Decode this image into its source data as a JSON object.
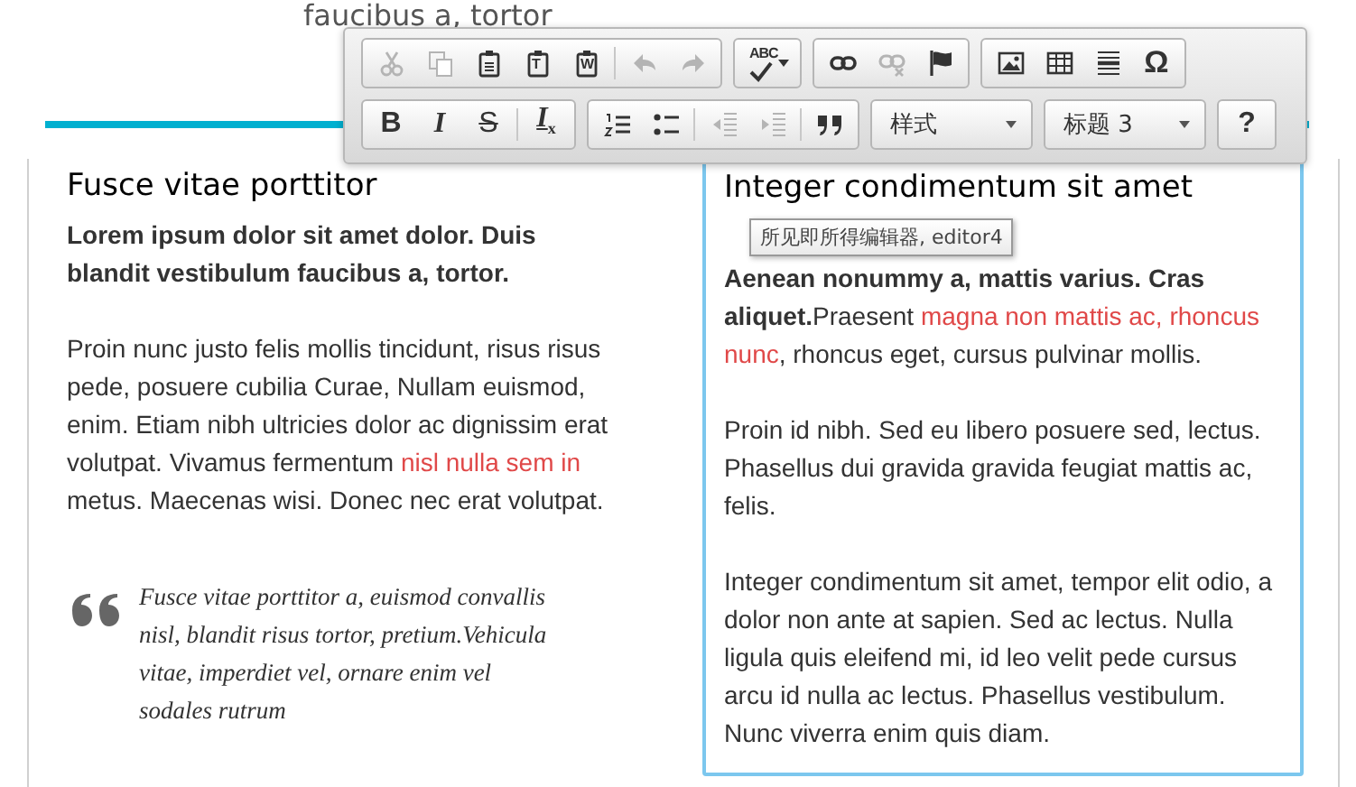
{
  "page_title": "faucibus a, tortor",
  "toolbar": {
    "rows": [
      [
        {
          "kind": "buttons",
          "items": [
            {
              "kind": "cut",
              "disabled": true
            },
            {
              "kind": "copy",
              "disabled": true
            },
            {
              "kind": "paste",
              "disabled": false
            },
            {
              "kind": "pasteletter",
              "glyph": "T",
              "disabled": false
            },
            {
              "kind": "pasteletter",
              "glyph": "W",
              "disabled": false
            },
            {
              "kind": "separator"
            },
            {
              "kind": "undo",
              "disabled": true
            },
            {
              "kind": "redo",
              "disabled": true
            }
          ]
        },
        {
          "kind": "buttons",
          "items": [
            {
              "kind": "spellcheck",
              "glyph": "ABC",
              "disabled": false
            }
          ]
        },
        {
          "kind": "buttons",
          "items": [
            {
              "kind": "link",
              "disabled": false
            },
            {
              "kind": "unlink",
              "disabled": true
            },
            {
              "kind": "flag",
              "disabled": false
            }
          ]
        },
        {
          "kind": "buttons",
          "items": [
            {
              "kind": "image",
              "disabled": false
            },
            {
              "kind": "table",
              "disabled": false
            },
            {
              "kind": "rule",
              "disabled": false
            },
            {
              "kind": "text",
              "glyph": "Ω",
              "disabled": false
            }
          ]
        }
      ],
      [
        {
          "kind": "buttons",
          "items": [
            {
              "kind": "bold",
              "glyph": "B",
              "disabled": false
            },
            {
              "kind": "italic",
              "glyph": "I",
              "disabled": false
            },
            {
              "kind": "strike",
              "glyph": "S",
              "disabled": false
            },
            {
              "kind": "separator"
            },
            {
              "kind": "format",
              "glyph": "I$_{x}$",
              "disabled": false
            }
          ]
        },
        {
          "kind": "buttons",
          "items": [
            {
              "kind": "numbered",
              "disabled": false
            },
            {
              "kind": "bullets",
              "disabled": false
            },
            {
              "kind": "separator"
            },
            {
              "kind": "outdent",
              "disabled": true
            },
            {
              "kind": "indent",
              "disabled": true
            },
            {
              "kind": "separator"
            },
            {
              "kind": "quote",
              "disabled": false
            }
          ]
        },
        {
          "kind": "dropdown",
          "label": "样式"
        },
        {
          "kind": "dropdown",
          "label": "标题 3"
        },
        {
          "kind": "buttons",
          "items": [
            {
              "kind": "bold",
              "glyph": "?",
              "disabled": false
            }
          ]
        }
      ]
    ]
  },
  "left_column": {
    "heading": "Fusce vitae porttitor",
    "paragraphs": [
      [
        {
          "kind": "strong",
          "text": "Lorem ipsum dolor sit amet dolor. Duis blandit vestibulum faucibus a, tortor."
        }
      ],
      [
        {
          "kind": "plain",
          "text": "Proin nunc justo felis mollis tincidunt, risus risus pede, posuere cubilia Curae, Nullam euismod, enim. Etiam nibh ultricies dolor ac dignissim erat volutpat. Vivamus fermentum "
        },
        {
          "kind": "marked",
          "text": "nisl nulla sem in"
        },
        {
          "kind": "plain",
          "text": " metus. Maecenas wisi. Donec nec erat volutpat."
        }
      ]
    ],
    "quote": "Fusce vitae porttitor a, euismod convallis nisl, blandit risus tortor, pretium.Vehicula vitae, imperdiet vel, ornare enim vel sodales rutrum"
  },
  "editor": {
    "focused": true,
    "heading": "Integer condimentum sit amet",
    "tooltip": "所见即所得编辑器, editor4",
    "paragraphs": [
      [
        {
          "kind": "strong",
          "text": "Aenean nonummy a, mattis varius. Cras aliquet."
        },
        {
          "kind": "plain",
          "text": "Praesent "
        },
        {
          "kind": "marked",
          "text": "magna non mattis ac, rhoncus nunc"
        },
        {
          "kind": "plain",
          "text": ", rhoncus eget, cursus pulvinar mollis."
        }
      ],
      [
        {
          "kind": "plain",
          "text": "Proin id nibh. Sed eu libero posuere sed, lectus. Phasellus dui gravida gravida feugiat mattis ac, felis."
        }
      ],
      [
        {
          "kind": "plain",
          "text": "Integer condimentum sit amet, tempor elit odio, a dolor non ante at sapien. Sed ac lectus. Nulla ligula quis eleifend mi, id leo velit pede cursus arcu id nulla ac lectus. Phasellus vestibulum. Nunc viverra enim quis diam."
        }
      ]
    ]
  }
}
